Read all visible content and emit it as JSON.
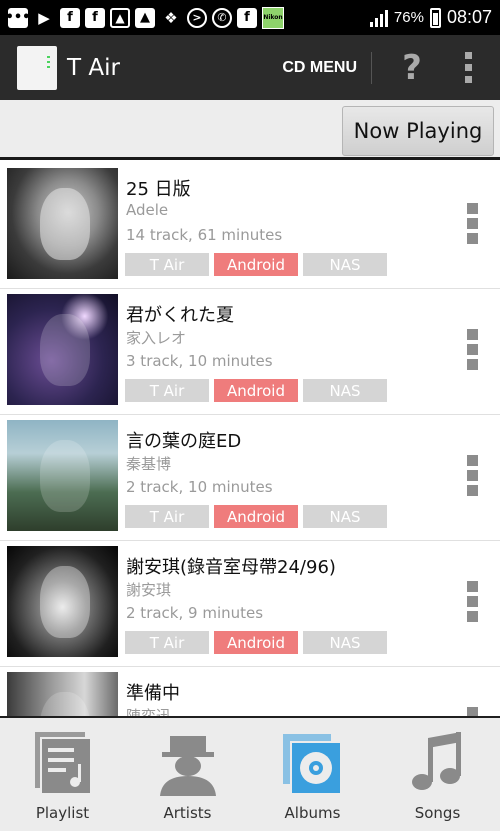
{
  "status_bar": {
    "icons": [
      "bbm-icon",
      "play-icon",
      "facebook-icon",
      "facebook-icon",
      "gallery-icon",
      "image-icon",
      "dropbox-icon",
      "circle-arrow-icon",
      "whatsapp-icon",
      "facebook-icon",
      "nikon-icon"
    ],
    "battery_percent": "76%",
    "time": "08:07"
  },
  "action_bar": {
    "title": "T Air",
    "cd_menu_label": "CD MENU",
    "help_label": "?"
  },
  "now_playing_label": "Now Playing",
  "albums": [
    {
      "title": "25 日版",
      "artist": "Adele",
      "tracks": "14 track, 61 minutes",
      "tags": [
        {
          "label": "T Air",
          "active": false
        },
        {
          "label": "Android",
          "active": true
        },
        {
          "label": "NAS",
          "active": false
        }
      ]
    },
    {
      "title": "君がくれた夏",
      "artist": "家入レオ",
      "tracks": "3 track, 10 minutes",
      "tags": [
        {
          "label": "T Air",
          "active": false
        },
        {
          "label": "Android",
          "active": true
        },
        {
          "label": "NAS",
          "active": false
        }
      ]
    },
    {
      "title": "言の葉の庭ED",
      "artist": "秦基博",
      "tracks": "2 track, 10 minutes",
      "tags": [
        {
          "label": "T Air",
          "active": false
        },
        {
          "label": "Android",
          "active": true
        },
        {
          "label": "NAS",
          "active": false
        }
      ]
    },
    {
      "title": "謝安琪(錄音室母帶24/96)",
      "artist": "謝安琪",
      "tracks": "2 track, 9 minutes",
      "tags": [
        {
          "label": "T Air",
          "active": false
        },
        {
          "label": "Android",
          "active": true
        },
        {
          "label": "NAS",
          "active": false
        }
      ]
    },
    {
      "title": "準備中",
      "artist": "陳奕迅",
      "tracks": "",
      "tags": []
    }
  ],
  "tabs": [
    {
      "label": "Playlist",
      "icon": "playlist-icon",
      "active": false
    },
    {
      "label": "Artists",
      "icon": "artists-icon",
      "active": false
    },
    {
      "label": "Albums",
      "icon": "albums-icon",
      "active": true
    },
    {
      "label": "Songs",
      "icon": "songs-icon",
      "active": false
    }
  ],
  "colors": {
    "active_tag": "#ef7c7c",
    "inactive_tag": "#d5d5d5",
    "active_tab": "#3a9fde",
    "inactive_tab": "#8a8a8a"
  }
}
